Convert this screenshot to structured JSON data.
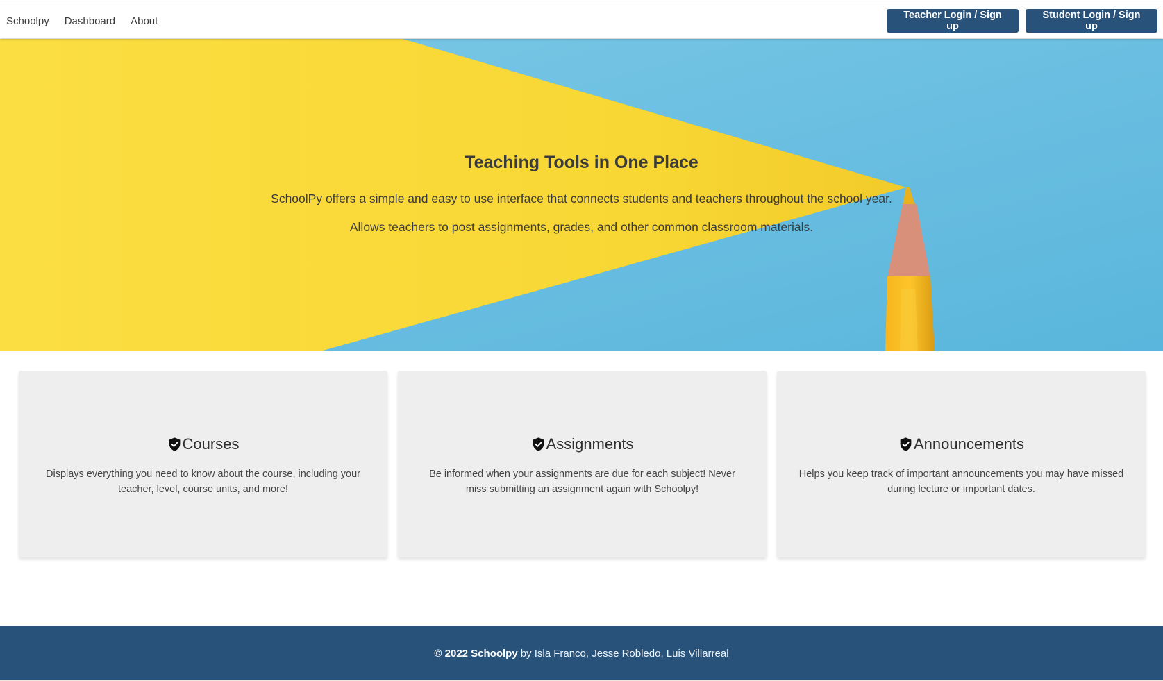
{
  "nav": {
    "brand": "Schoolpy",
    "links": [
      "Dashboard",
      "About"
    ],
    "teacher_button": "Teacher Login / Sign up",
    "student_button": "Student Login / Sign up"
  },
  "hero": {
    "title": "Teaching Tools in One Place",
    "line1": "SchoolPy offers a simple and easy to use interface that connects students and teachers throughout the school year.",
    "line2": "Allows teachers to post assignments, grades, and other common classroom materials.",
    "image": "yellow-pencil-on-blue-background"
  },
  "cards": [
    {
      "icon": "shield-check-icon",
      "title": "Courses",
      "text": "Displays everything you need to know about the course, including your teacher, level, course units, and more!"
    },
    {
      "icon": "shield-check-icon",
      "title": "Assignments",
      "text": "Be informed when your assignments are due for each subject! Never miss submitting an assignment again with Schoolpy!"
    },
    {
      "icon": "shield-check-icon",
      "title": "Announcements",
      "text": "Helps you keep track of important announcements you may have missed during lecture or important dates."
    }
  ],
  "footer": {
    "copyright": "© 2022 Schoolpy",
    "authors": "by Isla Franco, Jesse Robledo, Luis Villarreal"
  },
  "colors": {
    "primary": "#28527a",
    "hero_blue": "#6ec0e0",
    "hero_yellow": "#f9d837",
    "card_bg": "#eeeeee"
  }
}
